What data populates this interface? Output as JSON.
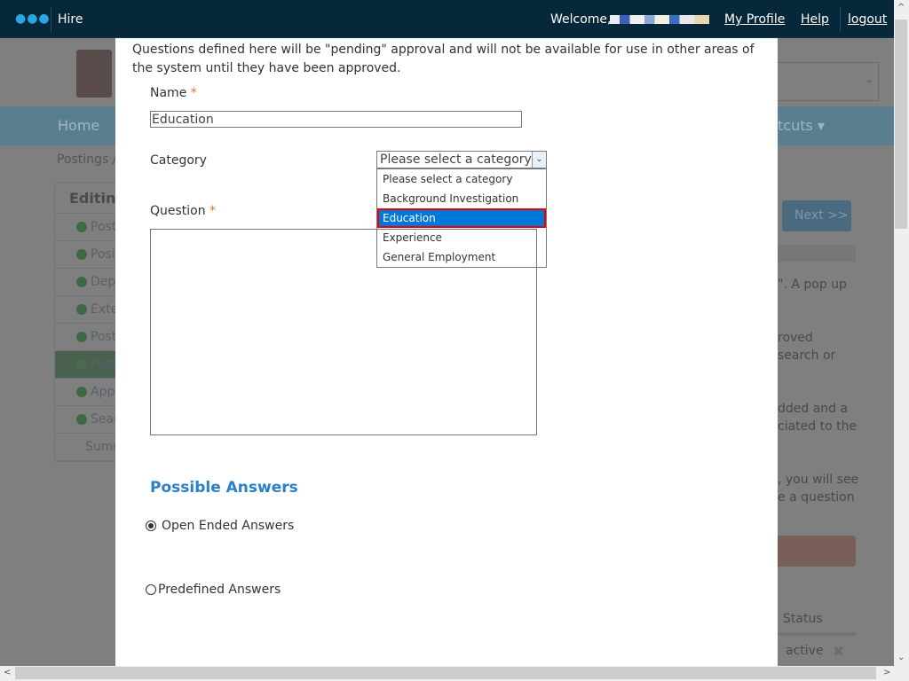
{
  "topbar": {
    "menu_icon": "dots-icon",
    "app_name": "Hire",
    "welcome": "Welcome,",
    "my_profile": "My Profile",
    "help": "Help",
    "logout": "logout"
  },
  "background": {
    "nav_home": "Home",
    "nav_shortcuts": "tcuts ▾",
    "breadcrumb": "Postings /",
    "sidebar_title": "Editing",
    "sidebar_items": [
      "Post",
      "Posi",
      "Depa",
      "Exte",
      "Post",
      "Post",
      "Appl",
      "Sear",
      "Summ"
    ],
    "next_button": "Next >>",
    "text_lines": [
      "\". A pop up",
      "roved",
      "search or",
      "dded and a",
      "ciated to the",
      ", you will see",
      "e a question"
    ],
    "table_header": "Status",
    "table_status": "active"
  },
  "modal": {
    "intro": "Questions defined here will be \"pending\" approval and will not be available for use in other areas of the system until they have been approved.",
    "name_label": "Name",
    "name_value": "Education",
    "required_mark": "*",
    "category_label": "Category",
    "category_selected": "Please select a category",
    "category_options": [
      "Please select a category",
      "Background Investigation",
      "Education",
      "Experience",
      "General Employment"
    ],
    "highlighted_option": "Education",
    "question_label": "Question",
    "question_value": "",
    "possible_answers_title": "Possible Answers",
    "answer_types": [
      {
        "label": "Open Ended Answers",
        "checked": true
      },
      {
        "label": "Predefined Answers",
        "checked": false
      }
    ]
  },
  "colors": {
    "topbar": "#06283a",
    "accent": "#2a7fc9",
    "selection": "#0078d7",
    "highlight_border": "#e00000",
    "required": "#e8702a"
  }
}
